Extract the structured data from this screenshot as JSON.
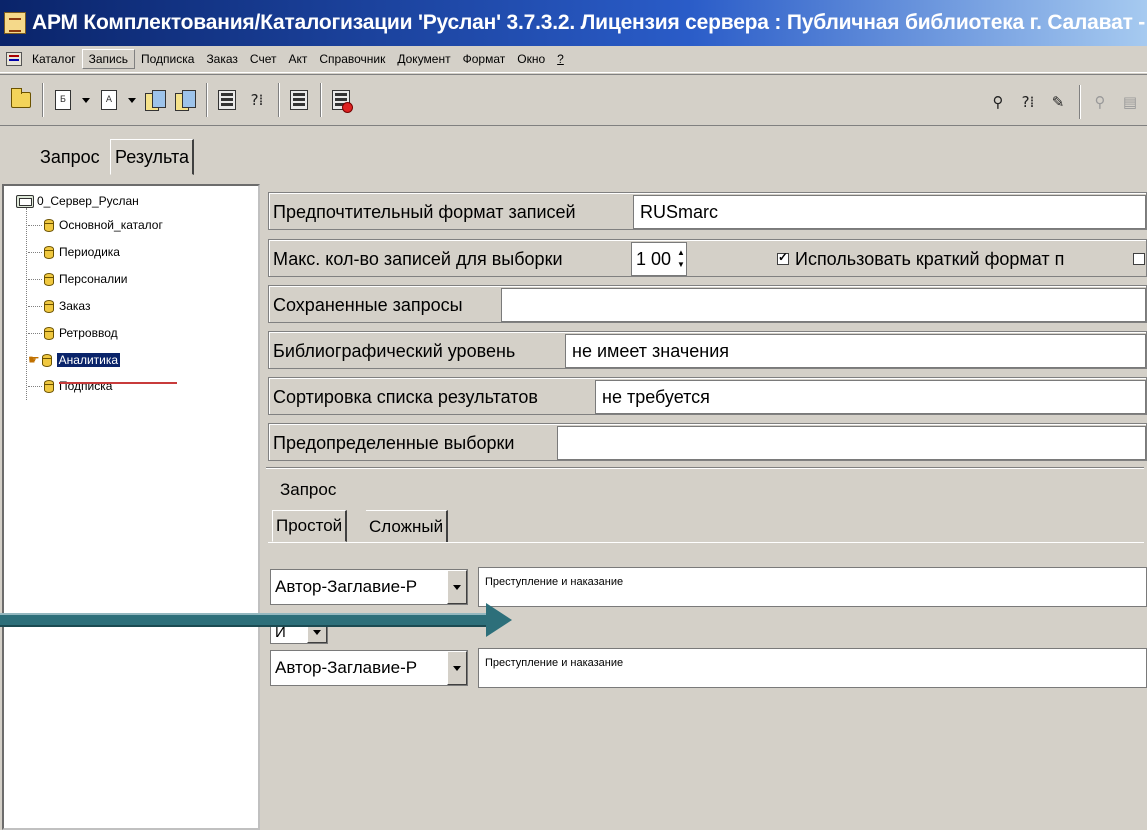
{
  "window": {
    "title": "АРМ Комплектования/Каталогизации 'Руслан' 3.7.3.2. Лицензия сервера : Публичная библиотека г. Салават - "
  },
  "menu": {
    "items": [
      "Каталог",
      "Запись",
      "Подписка",
      "Заказ",
      "Счет",
      "Акт",
      "Справочник",
      "Документ",
      "Формат",
      "Окно",
      "?"
    ]
  },
  "toolbar": {
    "doc_b_letter": "Б",
    "doc_a_letter": "А"
  },
  "tabs": {
    "query": "Запрос",
    "results": "Результа"
  },
  "tree": {
    "root": "0_Сервер_Руслан",
    "items": [
      {
        "label": "Основной_каталог"
      },
      {
        "label": "Периодика"
      },
      {
        "label": "Персоналии"
      },
      {
        "label": "Заказ"
      },
      {
        "label": "Ретроввод"
      },
      {
        "label": "Аналитика",
        "selected": true
      },
      {
        "label": "Подписка"
      }
    ]
  },
  "form": {
    "preferred_format_label": "Предпочтительный формат записей",
    "preferred_format_value": "RUSmarc",
    "max_records_label": "Макс. кол-во записей для выборки",
    "max_records_value": "1 00",
    "short_format_label": "Использовать краткий формат п",
    "short_format_checked": true,
    "saved_queries_label": "Сохраненные запросы",
    "saved_queries_value": "",
    "bib_level_label": "Библиографический уровень",
    "bib_level_value": "не имеет значения",
    "sort_label": "Сортировка списка результатов",
    "sort_value": "не требуется",
    "predefined_label": "Предопределенные выборки",
    "predefined_value": ""
  },
  "query": {
    "group_title": "Запрос",
    "tab_simple": "Простой",
    "tab_complex": "Сложный",
    "field1": "Автор-Заглавие-Р",
    "text1": "Преступление и наказание",
    "operator": "И",
    "field2": "Автор-Заглавие-Р",
    "text2": "Преступление и наказание"
  },
  "colors": {
    "titlebar_start": "#0a246a",
    "selection": "#0a246a",
    "annotation_arrow": "#2d6f7a",
    "annotation_underline": "#c83b3b"
  }
}
